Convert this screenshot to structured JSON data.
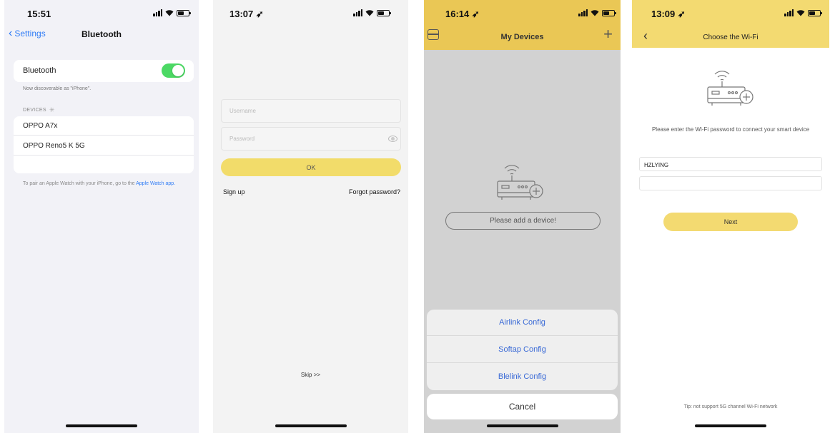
{
  "screen1": {
    "time": "15:51",
    "back_label": "Settings",
    "title": "Bluetooth",
    "bluetooth_label": "Bluetooth",
    "bluetooth_on": true,
    "discoverable_note": "Now discoverable as \"iPhone\".",
    "devices_header": "DEVICES",
    "devices": [
      "OPPO A7x",
      "OPPO Reno5 K 5G"
    ],
    "footer_text": "To pair an Apple Watch with your iPhone, go to the",
    "footer_link": "Apple Watch app."
  },
  "screen2": {
    "time": "13:07",
    "username_placeholder": "Username",
    "password_placeholder": "Password",
    "ok_label": "OK",
    "signup_label": "Sign up",
    "forgot_label": "Forgot password?",
    "skip_label": "Skip >>"
  },
  "screen3": {
    "time": "16:14",
    "title": "My Devices",
    "add_prompt": "Please add a device!",
    "sheet_options": [
      "Airlink Config",
      "Softap Config",
      "Blelink Config"
    ],
    "cancel_label": "Cancel"
  },
  "screen4": {
    "time": "13:09",
    "title": "Choose the Wi-Fi",
    "description": "Please enter the Wi-Fi password to connect your smart device",
    "ssid_value": "HZLYING",
    "password_value": "",
    "next_label": "Next",
    "tip": "Tip: not support 5G channel Wi-Fi network"
  },
  "colors": {
    "ios_toggle_on": "#4cd964",
    "ios_link": "#2f7cf6",
    "app_yellow": "#f3da71",
    "app_yellow_dark": "#eac755",
    "sheet_option_blue": "#3a6ad6"
  },
  "icons": {
    "router": "router-with-plus-icon",
    "back": "chevron-left-icon",
    "menu": "menu-icon",
    "add": "plus-icon",
    "signal": "cellular-signal-icon",
    "wifi": "wifi-icon",
    "battery": "battery-icon",
    "eye": "eye-icon"
  }
}
